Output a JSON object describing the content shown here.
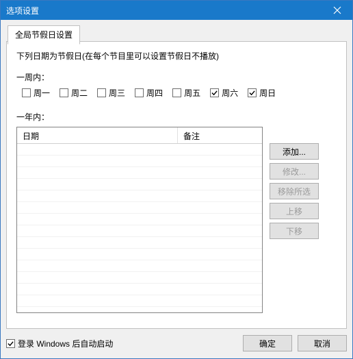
{
  "window": {
    "title": "选项设置"
  },
  "tab": {
    "label": "全局节假日设置"
  },
  "desc": "下列日期为节假日(在每个节目里可以设置节假日不播放)",
  "week": {
    "section_label": "一周内：",
    "days": [
      {
        "label": "周一",
        "checked": false
      },
      {
        "label": "周二",
        "checked": false
      },
      {
        "label": "周三",
        "checked": false
      },
      {
        "label": "周四",
        "checked": false
      },
      {
        "label": "周五",
        "checked": false
      },
      {
        "label": "周六",
        "checked": true
      },
      {
        "label": "周日",
        "checked": true
      }
    ]
  },
  "year": {
    "section_label": "一年内：",
    "columns": {
      "date": "日期",
      "note": "备注"
    },
    "buttons": {
      "add": "添加...",
      "edit": "修改...",
      "remove": "移除所选",
      "up": "上移",
      "down": "下移"
    }
  },
  "footer": {
    "autostart_label": "登录 Windows 后自动启动",
    "autostart_checked": true,
    "ok": "确定",
    "cancel": "取消"
  }
}
